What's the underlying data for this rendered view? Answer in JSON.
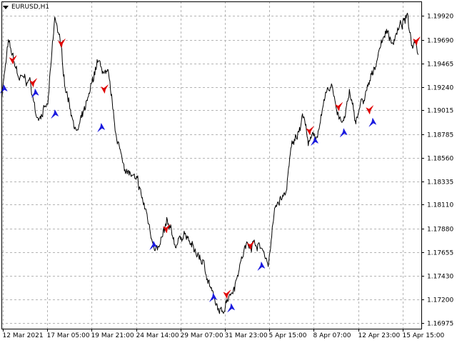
{
  "header": {
    "symbol_timeframe": "EURUSD,H1",
    "menu_icon": "triangle-down-icon"
  },
  "colors": {
    "background": "#ffffff",
    "grid": "#b4b4b4",
    "price_line": "#000000",
    "sell_arrow": "#e00000",
    "buy_arrow": "#1a1adf"
  },
  "chart_data": {
    "type": "line",
    "grid": true,
    "price_axis_position": "right",
    "y_ticks": [
      1.16975,
      1.172,
      1.1743,
      1.17655,
      1.1788,
      1.1811,
      1.18335,
      1.1856,
      1.18785,
      1.19015,
      1.1924,
      1.19465,
      1.1969,
      1.1992
    ],
    "ylim": [
      1.1692,
      1.2006
    ],
    "x_tick_labels": [
      "12 Mar 2021",
      "17 Mar 05:00",
      "19 Mar 21:00",
      "24 Mar 14:00",
      "29 Mar 07:00",
      "31 Mar 23:00",
      "5 Apr 15:00",
      "8 Apr 07:00",
      "12 Apr 23:00",
      "15 Apr 15:00"
    ],
    "bar_count": 720,
    "anchors": [
      [
        0,
        1.1915
      ],
      [
        12,
        1.1965
      ],
      [
        30,
        1.1932
      ],
      [
        50,
        1.1928
      ],
      [
        60,
        1.1895
      ],
      [
        80,
        1.1906
      ],
      [
        92,
        1.1988
      ],
      [
        100,
        1.1972
      ],
      [
        110,
        1.1925
      ],
      [
        130,
        1.188
      ],
      [
        150,
        1.191
      ],
      [
        165,
        1.1948
      ],
      [
        185,
        1.193
      ],
      [
        200,
        1.187
      ],
      [
        215,
        1.1845
      ],
      [
        235,
        1.183
      ],
      [
        250,
        1.1802
      ],
      [
        260,
        1.1778
      ],
      [
        272,
        1.1768
      ],
      [
        285,
        1.1792
      ],
      [
        300,
        1.1772
      ],
      [
        315,
        1.1785
      ],
      [
        330,
        1.1768
      ],
      [
        345,
        1.1758
      ],
      [
        360,
        1.1735
      ],
      [
        370,
        1.1712
      ],
      [
        380,
        1.1705
      ],
      [
        390,
        1.1724
      ],
      [
        400,
        1.1732
      ],
      [
        410,
        1.1752
      ],
      [
        420,
        1.177
      ],
      [
        435,
        1.1776
      ],
      [
        450,
        1.1768
      ],
      [
        460,
        1.1755
      ],
      [
        472,
        1.1808
      ],
      [
        480,
        1.1815
      ],
      [
        490,
        1.182
      ],
      [
        500,
        1.1865
      ],
      [
        510,
        1.1878
      ],
      [
        520,
        1.19
      ],
      [
        530,
        1.187
      ],
      [
        545,
        1.188
      ],
      [
        560,
        1.1915
      ],
      [
        570,
        1.1925
      ],
      [
        580,
        1.19
      ],
      [
        590,
        1.1888
      ],
      [
        600,
        1.1918
      ],
      [
        610,
        1.189
      ],
      [
        618,
        1.1905
      ],
      [
        628,
        1.1915
      ],
      [
        640,
        1.1935
      ],
      [
        650,
        1.1958
      ],
      [
        662,
        1.1978
      ],
      [
        675,
        1.1968
      ],
      [
        688,
        1.1982
      ],
      [
        700,
        1.199
      ],
      [
        708,
        1.1965
      ],
      [
        715,
        1.1972
      ],
      [
        719,
        1.1955
      ]
    ],
    "sell_signals": [
      {
        "bar": 20,
        "price": 1.195
      },
      {
        "bar": 55,
        "price": 1.1928
      },
      {
        "bar": 104,
        "price": 1.1966
      },
      {
        "bar": 178,
        "price": 1.1922
      },
      {
        "bar": 285,
        "price": 1.1788
      },
      {
        "bar": 389,
        "price": 1.1725
      },
      {
        "bar": 430,
        "price": 1.1772
      },
      {
        "bar": 532,
        "price": 1.1882
      },
      {
        "bar": 582,
        "price": 1.1905
      },
      {
        "bar": 635,
        "price": 1.1902
      },
      {
        "bar": 716,
        "price": 1.1968
      }
    ],
    "buy_signals": [
      {
        "bar": 4,
        "price": 1.1922
      },
      {
        "bar": 58,
        "price": 1.1918
      },
      {
        "bar": 92,
        "price": 1.1898
      },
      {
        "bar": 172,
        "price": 1.1885
      },
      {
        "bar": 262,
        "price": 1.1772
      },
      {
        "bar": 365,
        "price": 1.1722
      },
      {
        "bar": 396,
        "price": 1.1712
      },
      {
        "bar": 448,
        "price": 1.1752
      },
      {
        "bar": 540,
        "price": 1.1872
      },
      {
        "bar": 590,
        "price": 1.188
      },
      {
        "bar": 640,
        "price": 1.189
      }
    ]
  }
}
